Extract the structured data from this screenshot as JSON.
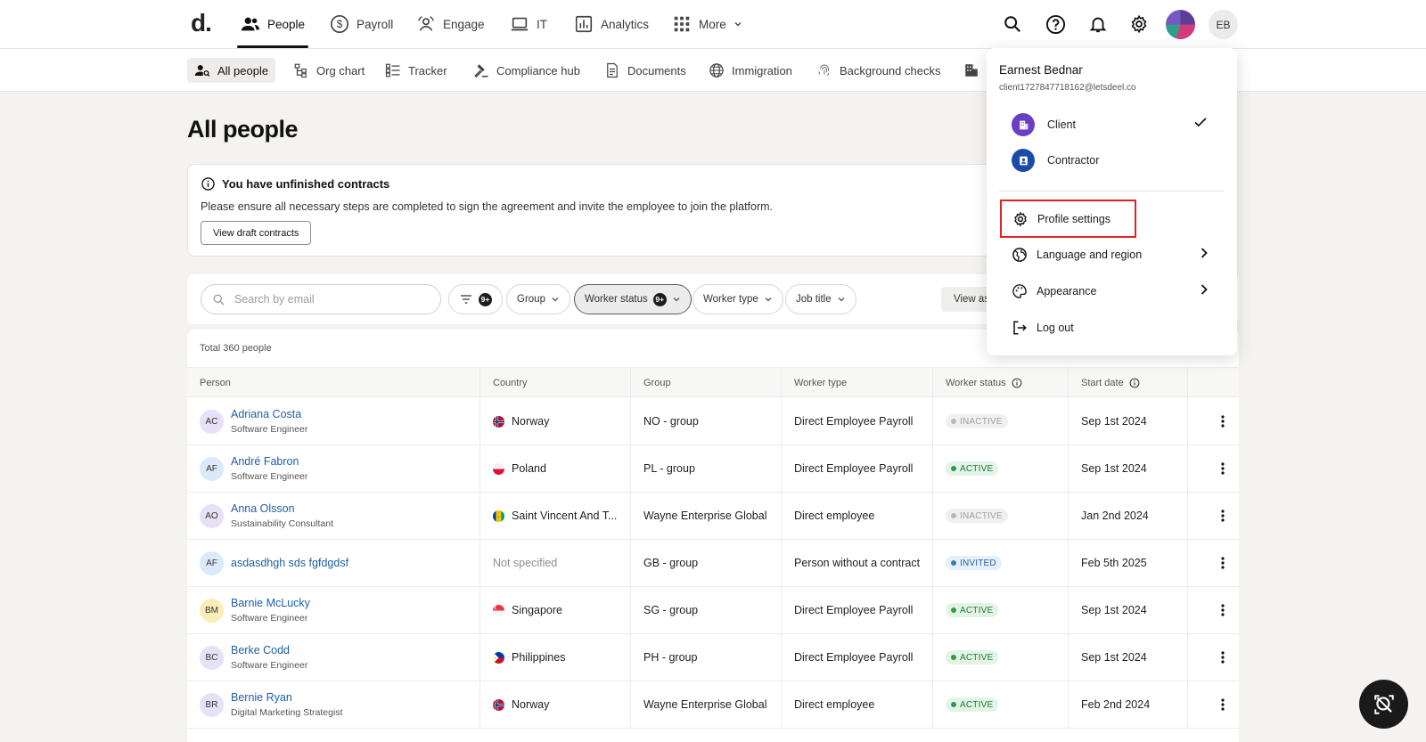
{
  "brand": {
    "logo": "d."
  },
  "nav": {
    "tabs": [
      {
        "label": "People",
        "icon": "people-icon",
        "active": true
      },
      {
        "label": "Payroll",
        "icon": "dollar-icon"
      },
      {
        "label": "Engage",
        "icon": "engage-icon"
      },
      {
        "label": "IT",
        "icon": "laptop-icon"
      },
      {
        "label": "Analytics",
        "icon": "chart-icon"
      },
      {
        "label": "More",
        "icon": "grid-icon"
      }
    ],
    "user_initials": "EB"
  },
  "subnav": {
    "tabs": [
      {
        "label": "All people",
        "icon": "person-search-icon",
        "active": true
      },
      {
        "label": "Org chart",
        "icon": "org-chart-icon"
      },
      {
        "label": "Tracker",
        "icon": "tracker-icon"
      },
      {
        "label": "Compliance hub",
        "icon": "gavel-icon"
      },
      {
        "label": "Documents",
        "icon": "document-icon"
      },
      {
        "label": "Immigration",
        "icon": "globe-icon"
      },
      {
        "label": "Background checks",
        "icon": "fingerprint-icon"
      }
    ]
  },
  "page": {
    "title": "All people"
  },
  "banner": {
    "title": "You have unfinished contracts",
    "text": "Please ensure all necessary steps are completed to sign the agreement and invite the employee to join the platform.",
    "button": "View draft contracts"
  },
  "filters": {
    "search_placeholder": "Search by email",
    "filter_badge": "9+",
    "chips": [
      {
        "label": "Group"
      },
      {
        "label": "Worker status",
        "badge": "9+",
        "selected": true
      },
      {
        "label": "Worker type"
      },
      {
        "label": "Job title"
      }
    ],
    "view_as": "View as"
  },
  "table": {
    "total": "Total 360 people",
    "columns": [
      "Person",
      "Country",
      "Group",
      "Worker type",
      "Worker status",
      "Start date"
    ],
    "rows": [
      {
        "initials": "AC",
        "avatar_color": "#e6e1f7",
        "name": "Adriana Costa",
        "role": "Software Engineer",
        "country": "Norway",
        "flag": "norway",
        "group": "NO - group",
        "worker_type": "Direct Employee Payroll",
        "status": "INACTIVE",
        "start": "Sep 1st 2024"
      },
      {
        "initials": "AF",
        "avatar_color": "#dbe9fb",
        "name": "André Fabron",
        "role": "Software Engineer",
        "country": "Poland",
        "flag": "poland",
        "group": "PL - group",
        "worker_type": "Direct Employee Payroll",
        "status": "ACTIVE",
        "start": "Sep 1st 2024"
      },
      {
        "initials": "AO",
        "avatar_color": "#e6e1f7",
        "name": "Anna Olsson",
        "role": "Sustainability Consultant",
        "country": "Saint Vincent And T...",
        "flag": "svg",
        "group": "Wayne Enterprise Global",
        "worker_type": "Direct employee",
        "status": "INACTIVE",
        "start": "Jan 2nd 2024"
      },
      {
        "initials": "AF",
        "avatar_color": "#dbe9fb",
        "name": "asdasdhgh sds fgfdgdsf",
        "role": "",
        "country": "Not specified",
        "flag": "",
        "group": "GB - group",
        "worker_type": "Person without a contract",
        "status": "INVITED",
        "start": "Feb 5th 2025"
      },
      {
        "initials": "BM",
        "avatar_color": "#faedb8",
        "name": "Barnie McLucky",
        "role": "Software Engineer",
        "country": "Singapore",
        "flag": "singapore",
        "group": "SG - group",
        "worker_type": "Direct Employee Payroll",
        "status": "ACTIVE",
        "start": "Sep 1st 2024"
      },
      {
        "initials": "BC",
        "avatar_color": "#e6e1f7",
        "name": "Berke Codd",
        "role": "Software Engineer",
        "country": "Philippines",
        "flag": "philippines",
        "group": "PH - group",
        "worker_type": "Direct Employee Payroll",
        "status": "ACTIVE",
        "start": "Sep 1st 2024"
      },
      {
        "initials": "BR",
        "avatar_color": "#e6e1f7",
        "name": "Bernie Ryan",
        "role": "Digital Marketing Strategist",
        "country": "Norway",
        "flag": "norway",
        "group": "Wayne Enterprise Global",
        "worker_type": "Direct employee",
        "status": "ACTIVE",
        "start": "Feb 2nd 2024"
      }
    ]
  },
  "profile_menu": {
    "name": "Earnest Bednar",
    "email": "client1727847718162@letsdeel.co",
    "roles": [
      {
        "label": "Client",
        "icon": "building-icon",
        "selected": true
      },
      {
        "label": "Contractor",
        "icon": "contractor-icon"
      }
    ],
    "items": [
      {
        "label": "Profile settings",
        "icon": "gear-icon"
      },
      {
        "label": "Language and region",
        "icon": "globe-icon"
      },
      {
        "label": "Appearance",
        "icon": "palette-icon"
      },
      {
        "label": "Log out",
        "icon": "logout-icon"
      }
    ]
  },
  "colors": {
    "link": "#1f5fa8",
    "highlight": "#e02424",
    "role_client": "#6a3fc5",
    "role_contractor": "#1c4aa8"
  }
}
